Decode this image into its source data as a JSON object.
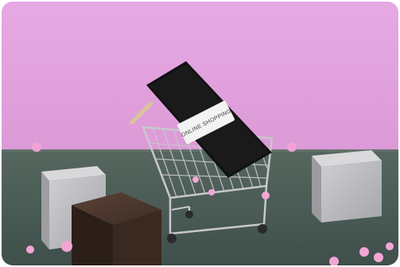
{
  "photo": {
    "phone_screen_text": "ONLINE SHOPPING",
    "colors": {
      "wall": "#e3a5e0",
      "table": "#4a5c57",
      "phone": "#111111",
      "cart_metal": "#c9c9cc",
      "grey_box": "#b9b9bd",
      "brown_box": "#3a2a22",
      "pink_balls": "#f2a6d6"
    }
  }
}
